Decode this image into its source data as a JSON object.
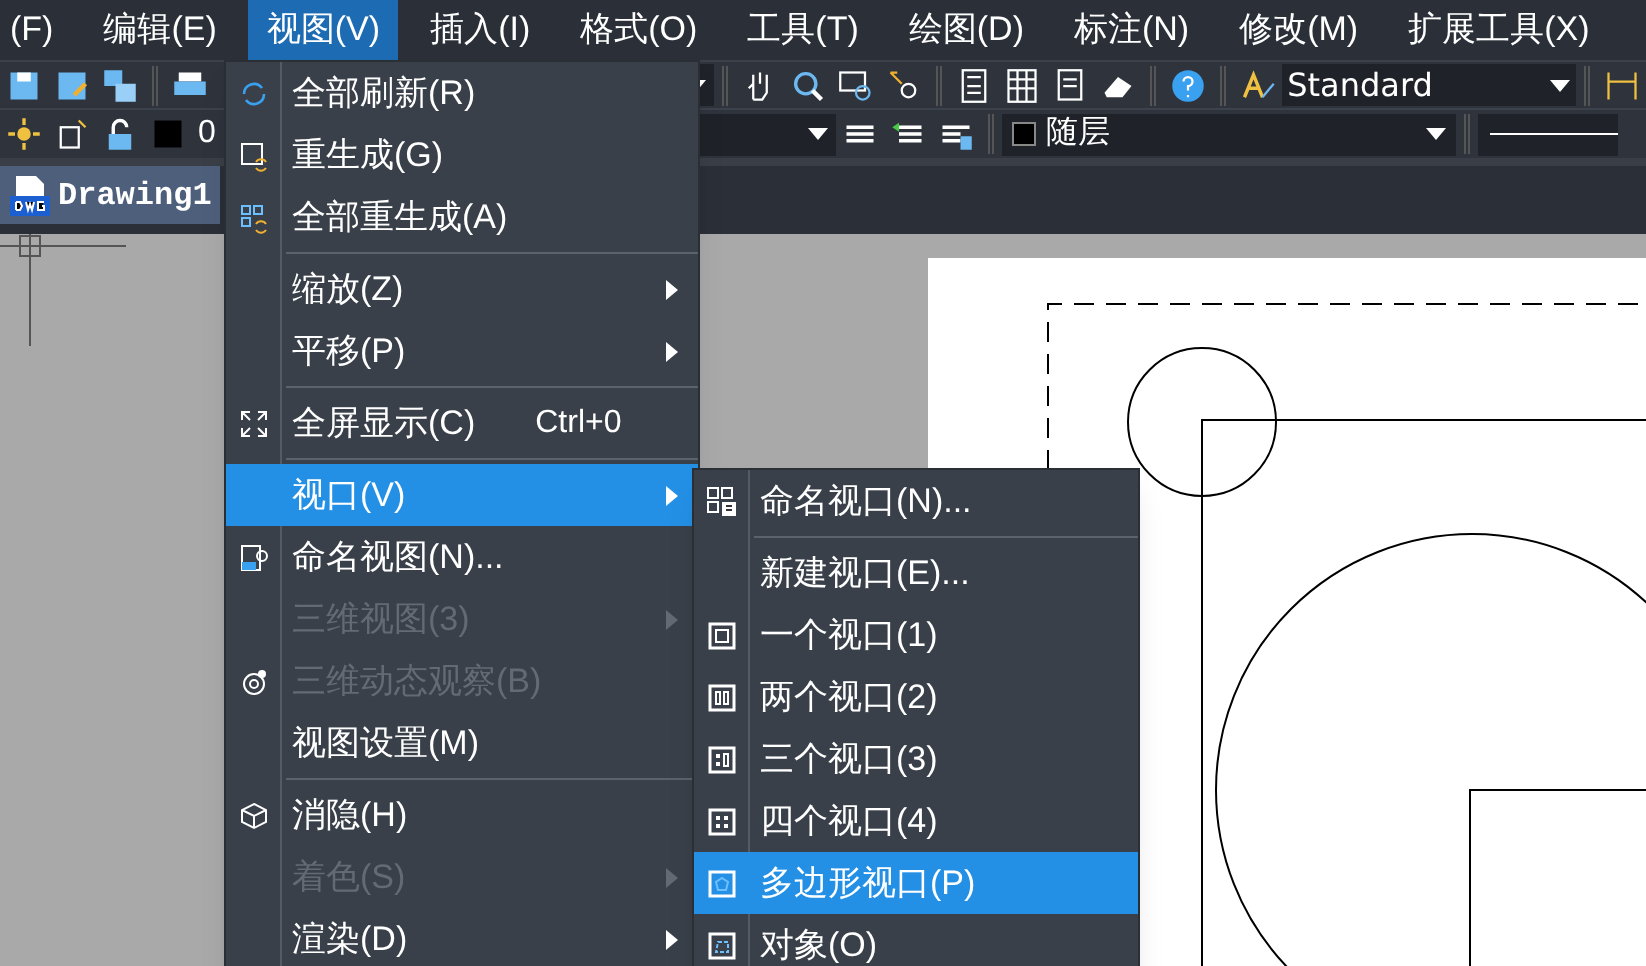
{
  "menubar": [
    {
      "label": "(F)",
      "selected": false
    },
    {
      "label": "编辑(E)",
      "selected": false
    },
    {
      "label": "视图(V)",
      "selected": true
    },
    {
      "label": "插入(I)",
      "selected": false
    },
    {
      "label": "格式(O)",
      "selected": false
    },
    {
      "label": "工具(T)",
      "selected": false
    },
    {
      "label": "绘图(D)",
      "selected": false
    },
    {
      "label": "标注(N)",
      "selected": false
    },
    {
      "label": "修改(M)",
      "selected": false
    },
    {
      "label": "扩展工具(X)",
      "selected": false
    }
  ],
  "toolbar": {
    "layer_name": "0",
    "text_style": "Standard",
    "color_setting": "随层"
  },
  "tab": {
    "title": "Drawing1",
    "selected": true
  },
  "view_menu": {
    "groups": [
      [
        {
          "label": "全部刷新(R)",
          "disabled": false,
          "selected": false,
          "submenu": false
        },
        {
          "label": "重生成(G)",
          "disabled": false,
          "selected": false,
          "submenu": false
        },
        {
          "label": "全部重生成(A)",
          "disabled": false,
          "selected": false,
          "submenu": false
        }
      ],
      [
        {
          "label": "缩放(Z)",
          "disabled": false,
          "selected": false,
          "submenu": true
        },
        {
          "label": "平移(P)",
          "disabled": false,
          "selected": false,
          "submenu": true
        }
      ],
      [
        {
          "label": "全屏显示(C)",
          "shortcut": "Ctrl+0",
          "disabled": false,
          "selected": false,
          "submenu": false
        }
      ],
      [
        {
          "label": "视口(V)",
          "disabled": false,
          "selected": true,
          "submenu": true
        },
        {
          "label": "命名视图(N)...",
          "disabled": false,
          "selected": false,
          "submenu": false
        },
        {
          "label": "三维视图(3)",
          "disabled": true,
          "selected": false,
          "submenu": true
        },
        {
          "label": "三维动态观察(B)",
          "disabled": true,
          "selected": false,
          "submenu": false
        },
        {
          "label": "视图设置(M)",
          "disabled": false,
          "selected": false,
          "submenu": false
        }
      ],
      [
        {
          "label": "消隐(H)",
          "disabled": false,
          "selected": false,
          "submenu": false
        },
        {
          "label": "着色(S)",
          "disabled": true,
          "selected": false,
          "submenu": true
        },
        {
          "label": "渲染(D)",
          "disabled": false,
          "selected": false,
          "submenu": true
        }
      ]
    ]
  },
  "viewport_submenu": {
    "groups": [
      [
        {
          "label": "命名视口(N)...",
          "disabled": false,
          "selected": false,
          "submenu": false
        }
      ],
      [
        {
          "label": "新建视口(E)...",
          "disabled": false,
          "selected": false,
          "submenu": false
        },
        {
          "label": "一个视口(1)",
          "disabled": false,
          "selected": false,
          "submenu": false
        },
        {
          "label": "两个视口(2)",
          "disabled": false,
          "selected": false,
          "submenu": false
        },
        {
          "label": "三个视口(3)",
          "disabled": false,
          "selected": false,
          "submenu": false
        },
        {
          "label": "四个视口(4)",
          "disabled": false,
          "selected": false,
          "submenu": false
        },
        {
          "label": "多边形视口(P)",
          "disabled": false,
          "selected": true,
          "submenu": false
        },
        {
          "label": "对象(O)",
          "disabled": false,
          "selected": false,
          "submenu": false
        }
      ]
    ]
  }
}
